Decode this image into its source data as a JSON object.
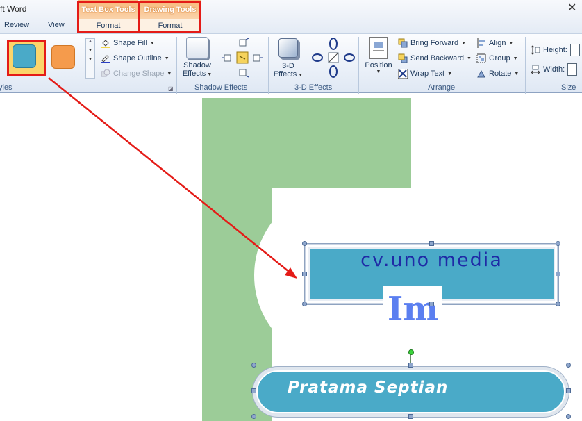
{
  "window": {
    "title": "ft Word",
    "close_glyph": "✕"
  },
  "tabs": {
    "review": "Review",
    "view": "View"
  },
  "contextual": {
    "textbox_tools": {
      "header": "Text Box Tools",
      "tab": "Format"
    },
    "drawing_tools": {
      "header": "Drawing Tools",
      "tab": "Format"
    },
    "colors": {
      "header_fill": "#f4a35a",
      "highlight": "#e41b17"
    }
  },
  "ribbon": {
    "styles": {
      "label": "yles",
      "swatches": [
        {
          "name": "blue-style",
          "color": "#4aaac8"
        },
        {
          "name": "orange-style",
          "color": "#f59b4c"
        }
      ],
      "shape_fill": "Shape Fill",
      "shape_outline": "Shape Outline",
      "change_shape": "Change Shape"
    },
    "shadow": {
      "label": "Shadow Effects",
      "button_line1": "Shadow",
      "button_line2": "Effects"
    },
    "threed": {
      "label": "3-D Effects",
      "button_line1": "3-D",
      "button_line2": "Effects"
    },
    "arrange": {
      "label": "Arrange",
      "position": "Position",
      "bring_forward": "Bring Forward",
      "send_backward": "Send Backward",
      "wrap_text": "Wrap Text",
      "align": "Align",
      "group": "Group",
      "rotate": "Rotate"
    },
    "size": {
      "label": "Size",
      "height": "Height:",
      "width": "Width:"
    }
  },
  "document": {
    "banner_text": "cv.uno media",
    "logo_text": "Im",
    "name_text": "Pratama Septian",
    "colors": {
      "green": "#9ccc98",
      "teal": "#4aaac8",
      "navy": "#1f2aa6",
      "logo_blue": "#5b7ff0"
    }
  }
}
